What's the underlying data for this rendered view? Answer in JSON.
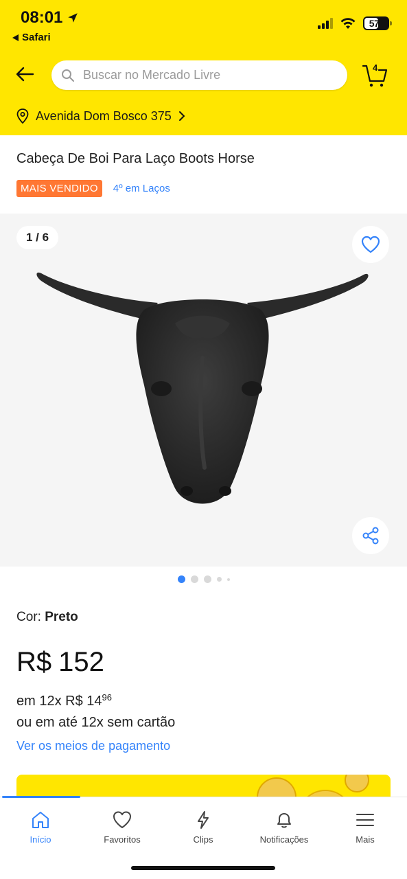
{
  "status_bar": {
    "time": "08:01",
    "back_app": "Safari",
    "battery": "57"
  },
  "header": {
    "search_placeholder": "Buscar no Mercado Livre",
    "cart_count": "4",
    "address": "Avenida Dom Bosco 375"
  },
  "product": {
    "title": "Cabeça De Boi Para Laço Boots Horse",
    "badge": "MAIS VENDIDO",
    "rank": "4º em Laços",
    "image_counter": "1 / 6",
    "color_label": "Cor:",
    "color_value": "Preto",
    "price_currency": "R$",
    "price_value": "152",
    "installments_prefix": "em 12x R$ 14",
    "installments_cents": "96",
    "no_card_text": "ou em até 12x sem cartão",
    "payment_link": "Ver os meios de pagamento"
  },
  "gallery": {
    "background": "#f5f5f5",
    "dots_total": 5,
    "active_dot": 0
  },
  "colors": {
    "brand_yellow": "#FFE600",
    "accent_blue": "#3483FA",
    "badge_orange": "#FF7733"
  },
  "bottom_nav": {
    "items": [
      {
        "label": "Início",
        "icon": "home-icon",
        "active": true
      },
      {
        "label": "Favoritos",
        "icon": "heart-icon",
        "active": false
      },
      {
        "label": "Clips",
        "icon": "lightning-icon",
        "active": false
      },
      {
        "label": "Notificações",
        "icon": "bell-icon",
        "active": false
      },
      {
        "label": "Mais",
        "icon": "menu-icon",
        "active": false
      }
    ]
  }
}
